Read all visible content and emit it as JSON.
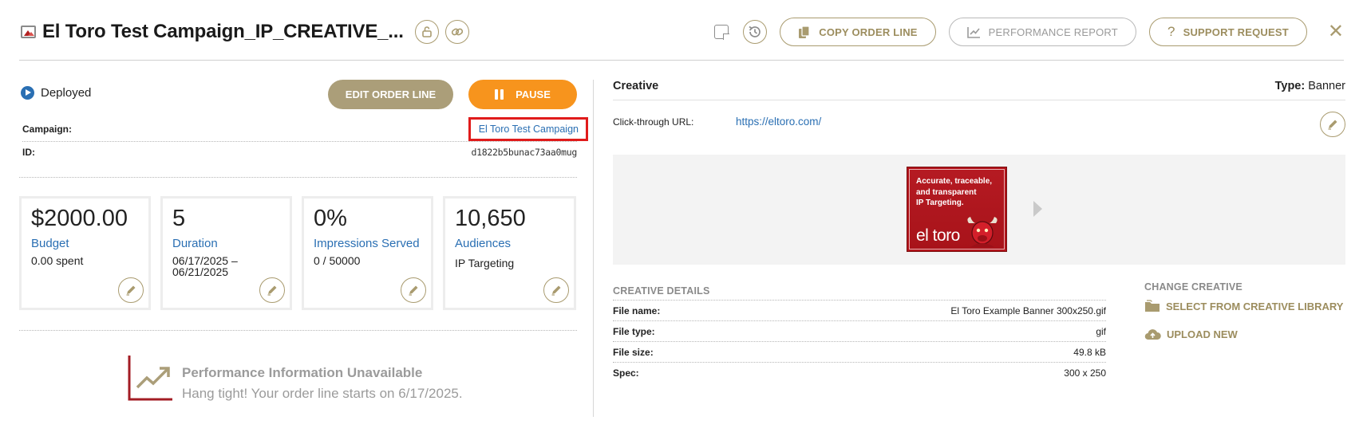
{
  "header": {
    "title": "El Toro Test Campaign_IP_CREATIVE_...",
    "copy_label": "COPY ORDER LINE",
    "performance_label": "PERFORMANCE REPORT",
    "support_label": "SUPPORT REQUEST",
    "close_label": "✕"
  },
  "left": {
    "status": "Deployed",
    "edit_label": "EDIT ORDER LINE",
    "pause_label": "PAUSE",
    "campaign_key": "Campaign:",
    "campaign_value": "El Toro Test Campaign",
    "id_key": "ID:",
    "id_value": "d1822b5bunac73aa0mug",
    "cards": [
      {
        "value": "$2000.00",
        "label": "Budget",
        "sub": "0.00 spent"
      },
      {
        "value": "5",
        "label": "Duration",
        "sub1": "06/17/2025 –",
        "sub2": "06/21/2025"
      },
      {
        "value": "0%",
        "label": "Impressions Served",
        "sub": "0 / 50000"
      },
      {
        "value": "10,650",
        "label": "Audiences",
        "sub": "IP Targeting"
      }
    ],
    "perf_title": "Performance Information Unavailable",
    "perf_sub": "Hang tight! Your order line starts on 6/17/2025."
  },
  "right": {
    "title": "Creative",
    "type_key": "Type:",
    "type_value": "Banner",
    "ctu_key": "Click-through URL:",
    "ctu_value": "https://eltoro.com/",
    "banner": {
      "line1": "Accurate, traceable,",
      "line2": "and transparent",
      "line3": "IP Targeting.",
      "logo": "el toro"
    },
    "details_title": "CREATIVE DETAILS",
    "details": [
      {
        "key": "File name:",
        "value": "El Toro Example Banner 300x250.gif"
      },
      {
        "key": "File type:",
        "value": "gif"
      },
      {
        "key": "File size:",
        "value": "49.8 kB"
      },
      {
        "key": "Spec:",
        "value": "300 x 250"
      }
    ],
    "change_title": "CHANGE CREATIVE",
    "library_label": "SELECT FROM CREATIVE LIBRARY",
    "upload_label": "UPLOAD NEW"
  },
  "colors": {
    "accent": "#a99b6f",
    "pause": "#f7941d",
    "link": "#2a6fb3",
    "highlight": "#e01b1b",
    "brand_red": "#b3131b"
  }
}
